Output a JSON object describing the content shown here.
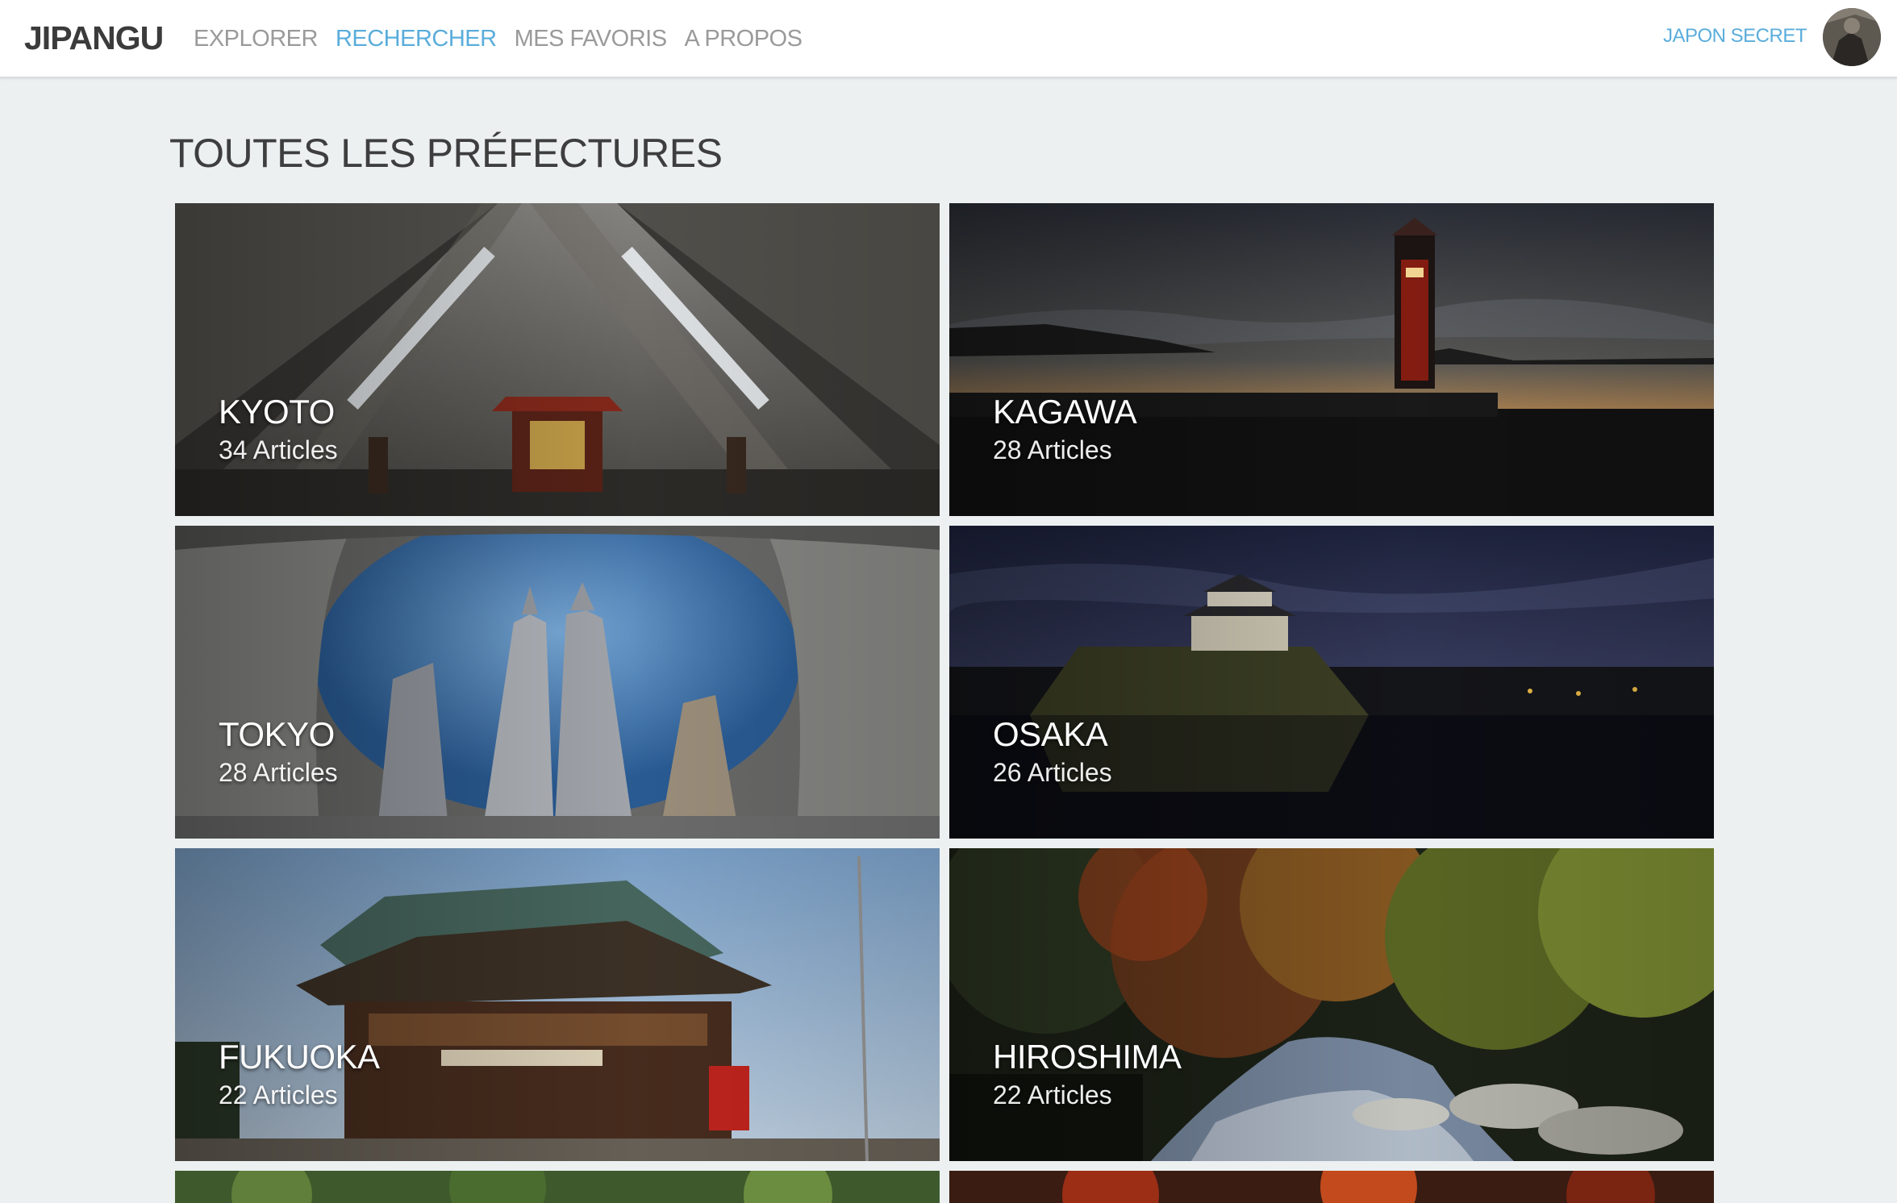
{
  "header": {
    "brand": "JIPANGU",
    "nav": [
      {
        "label": "EXPLORER",
        "active": false
      },
      {
        "label": "RECHERCHER",
        "active": true
      },
      {
        "label": "MES FAVORIS",
        "active": false
      },
      {
        "label": "A PROPOS",
        "active": false
      }
    ],
    "user_label": "JAPON SECRET"
  },
  "main": {
    "title": "TOUTES LES PRÉFECTURES",
    "prefectures": [
      {
        "name": "KYOTO",
        "count": "34 Articles"
      },
      {
        "name": "KAGAWA",
        "count": "28 Articles"
      },
      {
        "name": "TOKYO",
        "count": "28 Articles"
      },
      {
        "name": "OSAKA",
        "count": "26 Articles"
      },
      {
        "name": "FUKUOKA",
        "count": "22 Articles"
      },
      {
        "name": "HIROSHIMA",
        "count": "22 Articles"
      }
    ]
  },
  "colors": {
    "accent": "#5aaddb",
    "nav_inactive": "#9a9a9a",
    "background": "#ecf0f1"
  }
}
